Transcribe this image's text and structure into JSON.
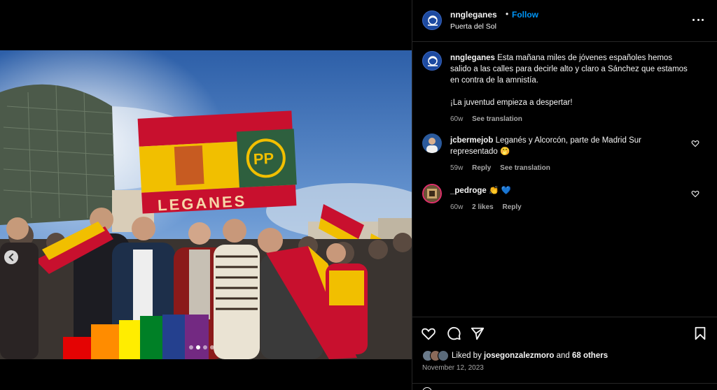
{
  "post": {
    "username": "nngleganes",
    "separator": "•",
    "follow_label": "Follow",
    "location": "Puerta del Sol",
    "caption_line1": "Esta mañana miles de jóvenes españoles hemos salido a las calles para decirle alto y claro a Sánchez que estamos en contra de la amnistía.",
    "caption_line2": "¡La juventud empieza a despertar!",
    "caption_time": "60w",
    "see_translation": "See translation"
  },
  "media": {
    "flag_text": "LEGANES",
    "logo_text": "PP",
    "carousel_dots": 4,
    "active_dot": 1
  },
  "comments": [
    {
      "username": "jcbermejob",
      "text": "Leganés y Alcorcón, parte de Madrid Sur representado 🤭",
      "time": "59w",
      "reply": "Reply",
      "see_translation": "See translation"
    },
    {
      "username": "_pedroge",
      "text": "👏 💙",
      "time": "60w",
      "likes": "2 likes",
      "reply": "Reply"
    }
  ],
  "likes": {
    "prefix": "Liked by",
    "user": "josegonzalezmoro",
    "conj": "and",
    "others": "68 others"
  },
  "date": "November 12, 2023",
  "icons": [
    "heart-icon",
    "comment-icon",
    "share-icon",
    "bookmark-icon",
    "more-icon"
  ],
  "colors": {
    "accent": "#0095f6",
    "background": "#000000",
    "muted": "#a8a8a8",
    "spain_red": "#c8102e",
    "spain_yellow": "#f1bf00",
    "pp_blue": "#1d4aa0"
  }
}
